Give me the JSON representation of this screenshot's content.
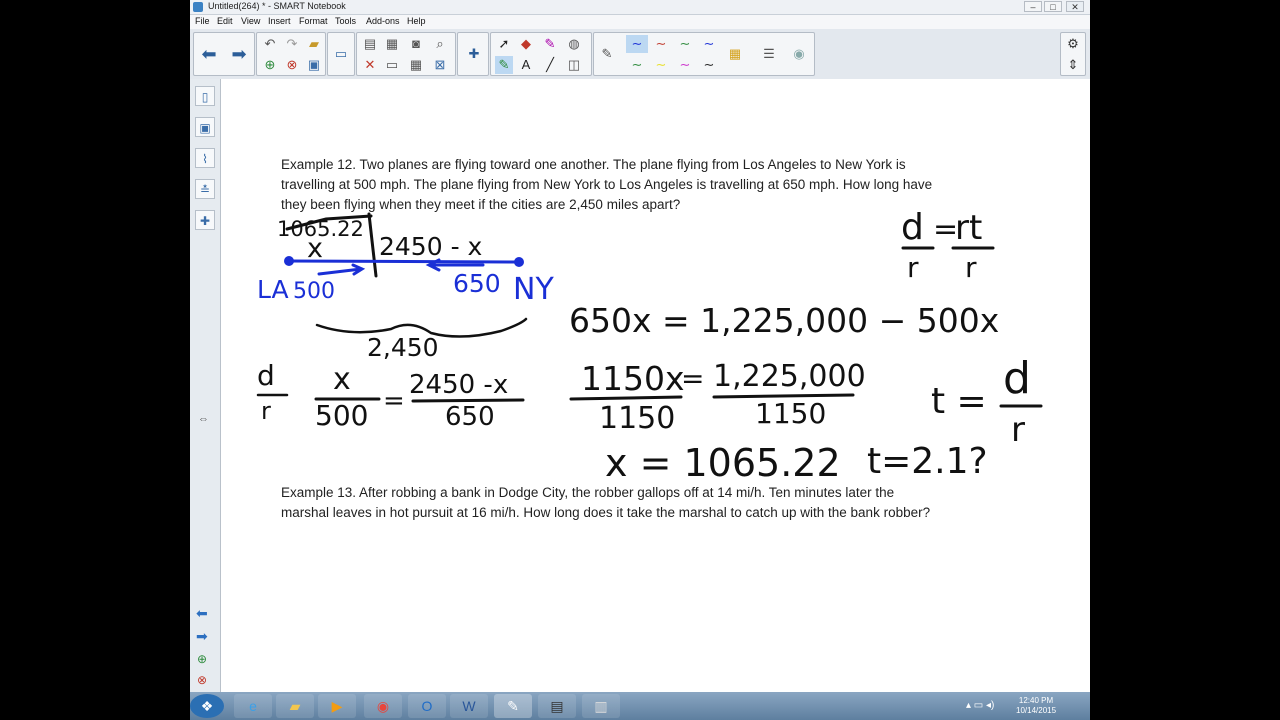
{
  "window": {
    "title": "Untitled(264) * - SMART Notebook"
  },
  "window_buttons": {
    "minimize": "–",
    "maximize": "□",
    "close": "✕"
  },
  "menu": [
    "File",
    "Edit",
    "View",
    "Insert",
    "Format",
    "Tools",
    "Add-ons",
    "Help"
  ],
  "examples": {
    "ex12_line1": "Example 12.    Two planes are flying toward one another.  The plane flying from Los Angeles to New York is",
    "ex12_line2": "travelling at 500 mph.  The plane flying from New York to Los Angeles is travelling at 650 mph.  How long have",
    "ex12_line3": "they been flying when they meet if the cities are 2,450 miles apart?",
    "ex13_line1": "Example 13.    After robbing a bank in Dodge City, the robber gallops off at 14 mi/h.  Ten minutes later the",
    "ex13_line2": "marshal leaves in hot pursuit at 16 mi/h.  How long does it take the marshal to catch up with the bank robber?"
  },
  "handwriting": {
    "top_value": "1065.22",
    "x_label": "x",
    "remaining": "2450 - x",
    "la_label": "LA",
    "la_speed": "500",
    "ny_speed": "650",
    "ny_label": "NY",
    "total": "2,450",
    "formula_d": "d",
    "formula_r": "r",
    "formula_rt": "rt",
    "eq1": "650x = 1,225,000 − 500x",
    "frac_left_num": "x",
    "frac_left_den": "500",
    "equals": "=",
    "frac_right_num": "2450 -x",
    "frac_right_den": "650",
    "frac3_num": "1150x",
    "frac3_eq": "=",
    "frac3_num2": "1,225,000",
    "frac3_den": "1150",
    "frac3_den2": "1150",
    "t_eq": "t =",
    "solution": "x = 1065.22",
    "t_partial": "t=2.1?"
  },
  "taskbar": {
    "clock_time": "12:40 PM",
    "clock_date": "10/14/2015"
  },
  "colors": {
    "ink_black": "#111111",
    "ink_blue": "#1a2fd6",
    "accent": "#3b82c4"
  }
}
